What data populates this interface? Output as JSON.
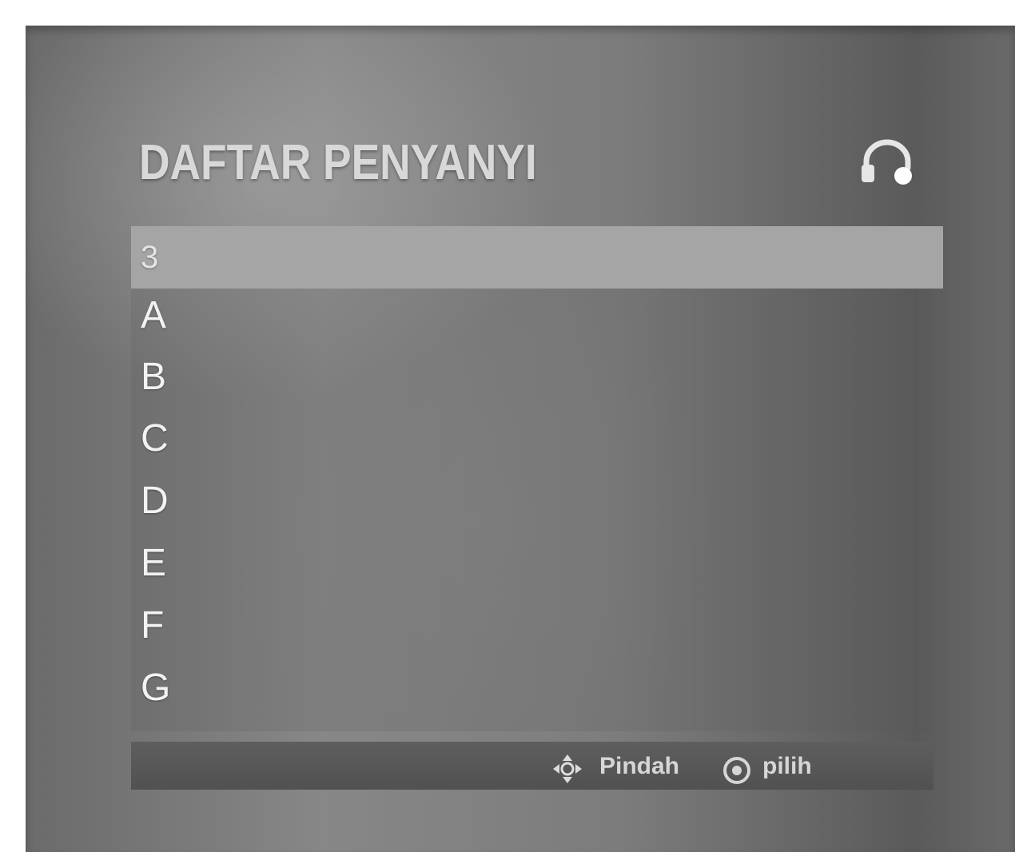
{
  "screen": {
    "title": "DAFTAR PENYANYI",
    "headphone_icon": "headphone-icon"
  },
  "list": {
    "selected_label": "3",
    "items": [
      "A",
      "B",
      "C",
      "D",
      "E",
      "F",
      "G"
    ]
  },
  "footer": {
    "move_icon": "dpad-icon",
    "move_label": "Pindah",
    "select_icon": "circle-select-icon",
    "select_label": "pilih"
  }
}
